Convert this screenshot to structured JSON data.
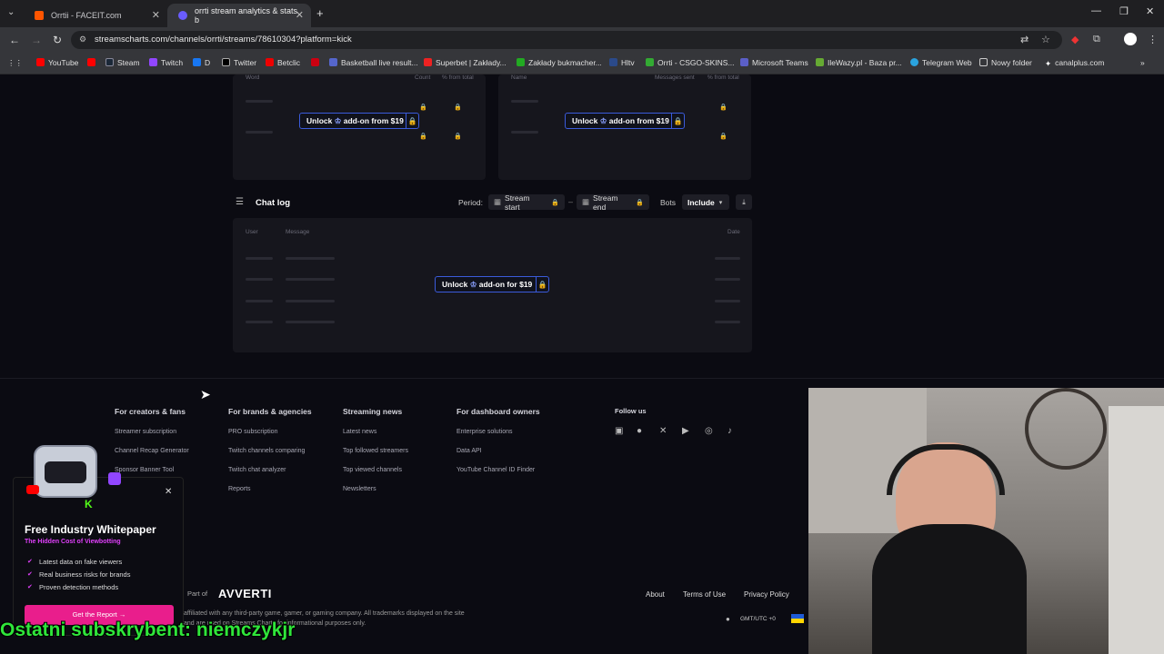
{
  "browser": {
    "tabs": [
      {
        "label": "Orrtii - FACEIT.com",
        "active": false
      },
      {
        "label": "orrti stream analytics & stats b",
        "active": true
      }
    ],
    "url": "streamscharts.com/channels/orrti/streams/78610304?platform=kick",
    "bookmarks": [
      "YouTube",
      "Steam",
      "Twitch",
      "D",
      "Twitter",
      "Betclic",
      "Basketball live result...",
      "Superbet | Zakłady...",
      "Zakłady bukmacher...",
      "Hltv",
      "Orrti - CSGO-SKINS...",
      "Microsoft Teams",
      "IleWazy.pl - Baza pr...",
      "Telegram Web",
      "Nowy folder",
      "canalplus.com"
    ]
  },
  "top_tables": {
    "left_headers": [
      "Word",
      "Count",
      "% from total"
    ],
    "right_headers": [
      "Name",
      "Messages sent",
      "% from total"
    ],
    "unlock_label": "Unlock",
    "addon_label": "add-on from $19"
  },
  "chat_log": {
    "title": "Chat log",
    "period_label": "Period:",
    "stream_start": "Stream start",
    "stream_end": "Stream end",
    "bots_label": "Bots",
    "bots_value": "Include",
    "columns": [
      "User",
      "Message",
      "Date"
    ],
    "unlock_label": "Unlock",
    "addon_label": "add-on for $19"
  },
  "footer": {
    "columns": [
      {
        "heading": "For creators & fans",
        "links": [
          "Streamer subscription",
          "Channel Recap Generator",
          "Sponsor Banner Tool"
        ]
      },
      {
        "heading": "For brands & agencies",
        "links": [
          "PRO subscription",
          "Twitch channels comparing",
          "Twitch chat analyzer",
          "Reports"
        ]
      },
      {
        "heading": "Streaming news",
        "links": [
          "Latest news",
          "Top followed streamers",
          "Top viewed channels",
          "Newsletters"
        ]
      },
      {
        "heading": "For dashboard owners",
        "links": [
          "Enterprise solutions",
          "Data API",
          "YouTube Channel ID Finder"
        ]
      }
    ],
    "follow_label": "Follow us",
    "part_of": "Part of",
    "brand": "AVVERTI",
    "links": [
      "About",
      "Terms of Use",
      "Privacy Policy"
    ],
    "disclaimer_1": "affiliated with any third-party game, gamer, or gaming company. All trademarks displayed on the site",
    "disclaimer_2": "and are used on Streams Charts for informational purposes only.",
    "timezone": "GMT/UTC +0"
  },
  "promo": {
    "title": "Free Industry Whitepaper",
    "subtitle": "The Hidden Cost of Viewbotting",
    "items": [
      "Latest data on fake viewers",
      "Real business risks for brands",
      "Proven detection methods"
    ],
    "cta": "Get the Report"
  },
  "stream_overlay": "Ostatni subskrybent: niemczykjr",
  "colors": {
    "accent": "#3b5bdb",
    "promo_accent": "#e91e8c",
    "overlay_text": "#2fe63a"
  }
}
